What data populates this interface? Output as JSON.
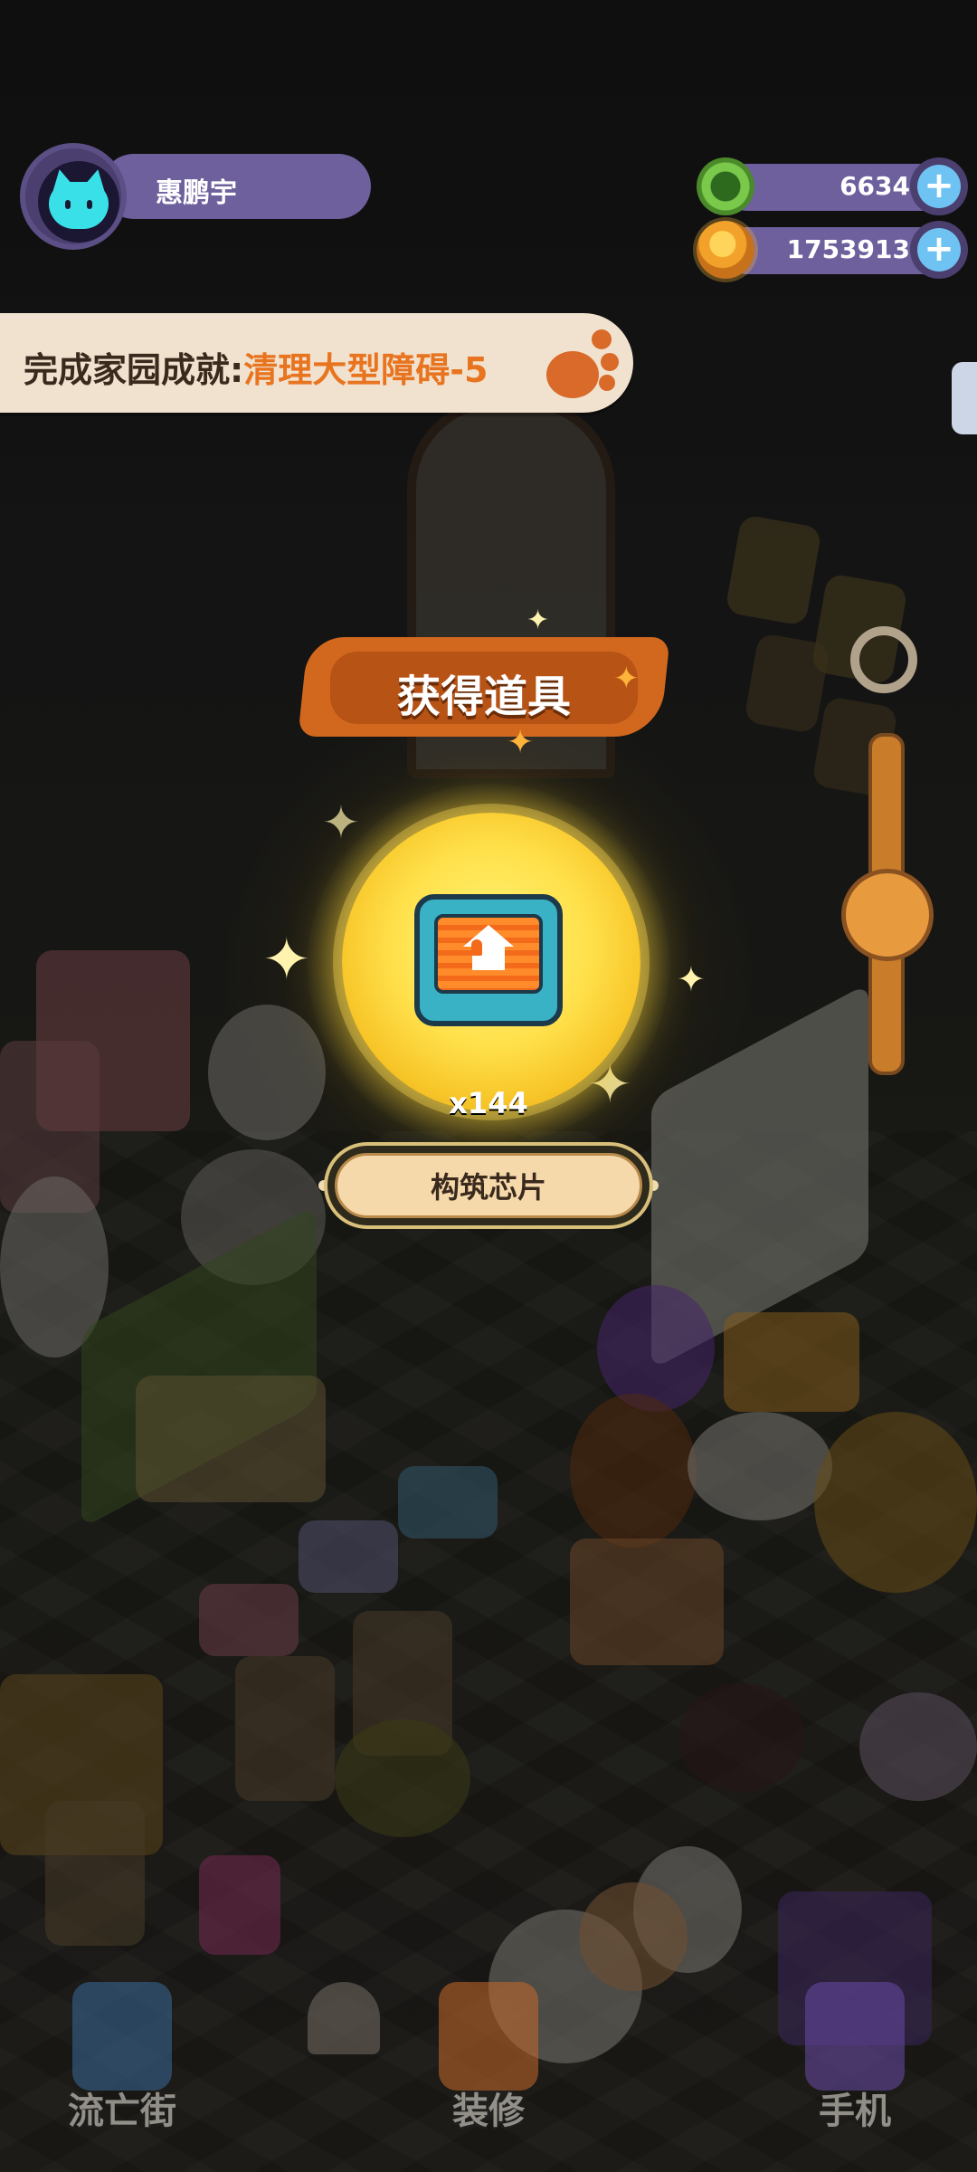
{
  "player": {
    "name": "惠鹏宇"
  },
  "currencies": [
    {
      "icon": "green-gem-coin-icon",
      "value": "6634",
      "color": "#7ac94a"
    },
    {
      "icon": "orange-planet-coin-icon",
      "value": "1753913",
      "color": "#f2a22a"
    }
  ],
  "quest": {
    "prefix": "完成家园成就:",
    "highlight": "清理大型障碍-5",
    "highlight_color": "#e8741f"
  },
  "reward_popup": {
    "title": "获得道具",
    "item_icon": "building-chip-icon",
    "quantity": "x144",
    "item_name": "构筑芯片"
  },
  "bottom_nav": {
    "left": {
      "label": "流亡街",
      "icon": "street-portal-icon"
    },
    "center": {
      "label": "装修",
      "icon": "decorate-toolbox-icon"
    },
    "right": {
      "label": "手机",
      "icon": "phone-icon"
    }
  },
  "colors": {
    "hud_bar": "#6e5f9d",
    "banner": "#d1681e",
    "coin_glow": "#ffe04a"
  }
}
